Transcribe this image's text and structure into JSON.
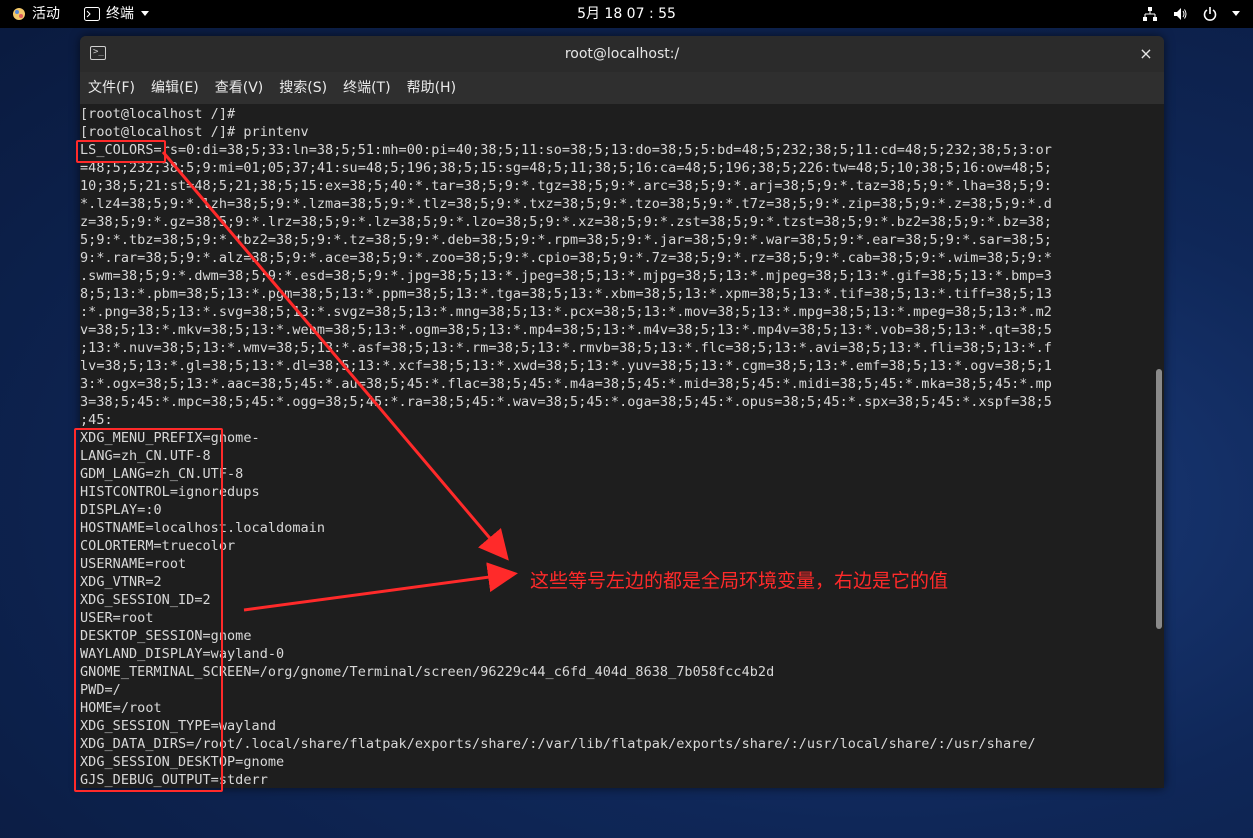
{
  "topbar": {
    "activities": "活动",
    "app_name": "终端",
    "clock": "5月 18  07 : 55"
  },
  "window": {
    "title": "root@localhost:/",
    "close": "×",
    "menu": [
      "文件(F)",
      "编辑(E)",
      "查看(V)",
      "搜索(S)",
      "终端(T)",
      "帮助(H)"
    ]
  },
  "terminal_lines": [
    "[root@localhost /]#",
    "[root@localhost /]# printenv",
    "LS_COLORS=rs=0:di=38;5;33:ln=38;5;51:mh=00:pi=40;38;5;11:so=38;5;13:do=38;5;5:bd=48;5;232;38;5;11:cd=48;5;232;38;5;3:or",
    "=48;5;232;38;5;9:mi=01;05;37;41:su=48;5;196;38;5;15:sg=48;5;11;38;5;16:ca=48;5;196;38;5;226:tw=48;5;10;38;5;16:ow=48;5;",
    "10;38;5;21:st=48;5;21;38;5;15:ex=38;5;40:*.tar=38;5;9:*.tgz=38;5;9:*.arc=38;5;9:*.arj=38;5;9:*.taz=38;5;9:*.lha=38;5;9:",
    "*.lz4=38;5;9:*.lzh=38;5;9:*.lzma=38;5;9:*.tlz=38;5;9:*.txz=38;5;9:*.tzo=38;5;9:*.t7z=38;5;9:*.zip=38;5;9:*.z=38;5;9:*.d",
    "z=38;5;9:*.gz=38;5;9:*.lrz=38;5;9:*.lz=38;5;9:*.lzo=38;5;9:*.xz=38;5;9:*.zst=38;5;9:*.tzst=38;5;9:*.bz2=38;5;9:*.bz=38;",
    "5;9:*.tbz=38;5;9:*.tbz2=38;5;9:*.tz=38;5;9:*.deb=38;5;9:*.rpm=38;5;9:*.jar=38;5;9:*.war=38;5;9:*.ear=38;5;9:*.sar=38;5;",
    "9:*.rar=38;5;9:*.alz=38;5;9:*.ace=38;5;9:*.zoo=38;5;9:*.cpio=38;5;9:*.7z=38;5;9:*.rz=38;5;9:*.cab=38;5;9:*.wim=38;5;9:*",
    ".swm=38;5;9:*.dwm=38;5;9:*.esd=38;5;9:*.jpg=38;5;13:*.jpeg=38;5;13:*.mjpg=38;5;13:*.mjpeg=38;5;13:*.gif=38;5;13:*.bmp=3",
    "8;5;13:*.pbm=38;5;13:*.pgm=38;5;13:*.ppm=38;5;13:*.tga=38;5;13:*.xbm=38;5;13:*.xpm=38;5;13:*.tif=38;5;13:*.tiff=38;5;13",
    ":*.png=38;5;13:*.svg=38;5;13:*.svgz=38;5;13:*.mng=38;5;13:*.pcx=38;5;13:*.mov=38;5;13:*.mpg=38;5;13:*.mpeg=38;5;13:*.m2",
    "v=38;5;13:*.mkv=38;5;13:*.webm=38;5;13:*.ogm=38;5;13:*.mp4=38;5;13:*.m4v=38;5;13:*.mp4v=38;5;13:*.vob=38;5;13:*.qt=38;5",
    ";13:*.nuv=38;5;13:*.wmv=38;5;13:*.asf=38;5;13:*.rm=38;5;13:*.rmvb=38;5;13:*.flc=38;5;13:*.avi=38;5;13:*.fli=38;5;13:*.f",
    "lv=38;5;13:*.gl=38;5;13:*.dl=38;5;13:*.xcf=38;5;13:*.xwd=38;5;13:*.yuv=38;5;13:*.cgm=38;5;13:*.emf=38;5;13:*.ogv=38;5;1",
    "3:*.ogx=38;5;13:*.aac=38;5;45:*.au=38;5;45:*.flac=38;5;45:*.m4a=38;5;45:*.mid=38;5;45:*.midi=38;5;45:*.mka=38;5;45:*.mp",
    "3=38;5;45:*.mpc=38;5;45:*.ogg=38;5;45:*.ra=38;5;45:*.wav=38;5;45:*.oga=38;5;45:*.opus=38;5;45:*.spx=38;5;45:*.xspf=38;5",
    ";45:",
    "XDG_MENU_PREFIX=gnome-",
    "LANG=zh_CN.UTF-8",
    "GDM_LANG=zh_CN.UTF-8",
    "HISTCONTROL=ignoredups",
    "DISPLAY=:0",
    "HOSTNAME=localhost.localdomain",
    "COLORTERM=truecolor",
    "USERNAME=root",
    "XDG_VTNR=2",
    "XDG_SESSION_ID=2",
    "USER=root",
    "DESKTOP_SESSION=gnome",
    "WAYLAND_DISPLAY=wayland-0",
    "GNOME_TERMINAL_SCREEN=/org/gnome/Terminal/screen/96229c44_c6fd_404d_8638_7b058fcc4b2d",
    "PWD=/",
    "HOME=/root",
    "XDG_SESSION_TYPE=wayland",
    "XDG_DATA_DIRS=/root/.local/share/flatpak/exports/share/:/var/lib/flatpak/exports/share/:/usr/local/share/:/usr/share/",
    "XDG_SESSION_DESKTOP=gnome",
    "GJS_DEBUG_OUTPUT=stderr"
  ],
  "annotation": {
    "text": "这些等号左边的都是全局环境变量，右边是它的值",
    "color": "#ff2a2a"
  },
  "icons": [
    "activities-icon",
    "terminal-icon",
    "network-icon",
    "volume-icon",
    "power-icon",
    "chevron-down-icon",
    "close-icon"
  ]
}
